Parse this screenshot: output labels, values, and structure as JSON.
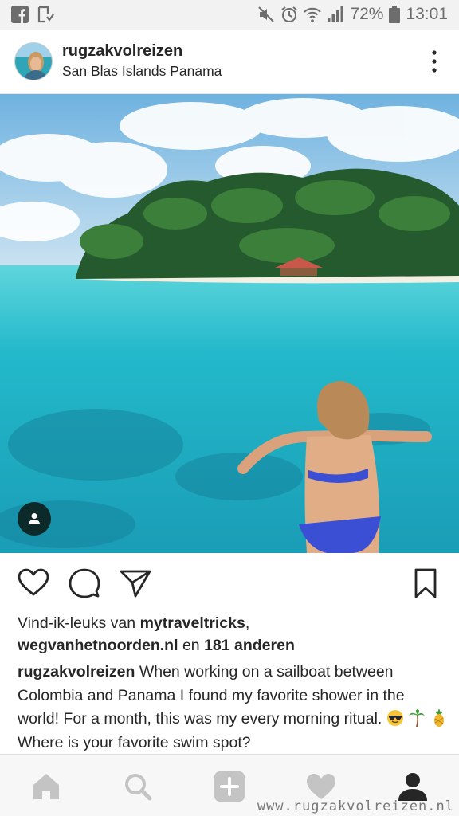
{
  "status_bar": {
    "battery": "72%",
    "time": "13:01",
    "left_icons": [
      "facebook-icon",
      "download-notification-icon"
    ],
    "right_icons": [
      "mute-icon",
      "alarm-icon",
      "wifi-icon",
      "signal-icon",
      "battery-icon"
    ]
  },
  "post": {
    "username": "rugzakvolreizen",
    "location": "San Blas Islands Panama",
    "actions": [
      "heart-icon",
      "comment-icon",
      "share-icon",
      "bookmark-icon"
    ],
    "likes": {
      "prefix": "Vind-ik-leuks van",
      "user1": "mytraveltricks",
      "separator": ",",
      "user2": "wegvanhetnoorden.nl",
      "conjunction": "en",
      "others": "181 anderen"
    },
    "caption": {
      "author": "rugzakvolreizen",
      "text": "When working on a sailboat between Colombia and Panama I found my favorite shower in the world! For a month, this was my every morning ritual.",
      "emojis": [
        "sunglasses-emoji",
        "palm-tree-emoji",
        "pineapple-emoji"
      ],
      "text_after": "Where is your favorite swim spot?"
    }
  },
  "bottom_nav": [
    "home-icon",
    "search-icon",
    "add-post-icon",
    "activity-heart-icon",
    "profile-icon"
  ],
  "watermark": "www.rugzakvolreizen.nl",
  "colors": {
    "text": "#262626",
    "water": "#22b8c8",
    "sky": "#8ec9ea",
    "status_bar": "#f2f2f2"
  }
}
